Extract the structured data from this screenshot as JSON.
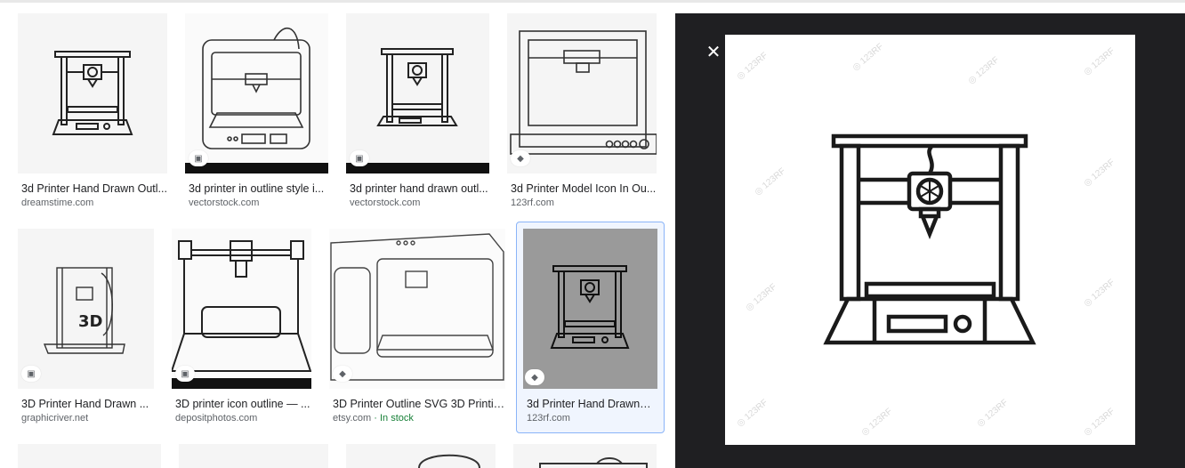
{
  "results": [
    {
      "title": "3d Printer Hand Drawn Outl...",
      "site": "dreamstime.com",
      "badge": "image-icon",
      "badge_show": false
    },
    {
      "title": "3d printer in outline style i...",
      "site": "vectorstock.com",
      "badge": "image-icon",
      "badge_show": true
    },
    {
      "title": "3d printer hand drawn outl...",
      "site": "vectorstock.com",
      "badge": "image-icon",
      "badge_show": true
    },
    {
      "title": "3d Printer Model Icon In Ou...",
      "site": "123rf.com",
      "badge": "tag-icon",
      "badge_show": true
    },
    {
      "title": "3D Printer Hand Drawn ...",
      "site": "graphicriver.net",
      "badge": "image-icon",
      "badge_show": true
    },
    {
      "title": "3D printer icon outline — ...",
      "site": "depositphotos.com",
      "badge": "image-icon",
      "badge_show": true
    },
    {
      "title": "3D Printer Outline SVG 3D Printin...",
      "site": "etsy.com",
      "stock": "· In stock",
      "badge": "tag-icon",
      "badge_show": true
    },
    {
      "title": "3d Printer Hand Drawn ...",
      "site": "123rf.com",
      "badge": "tag-icon",
      "badge_show": true
    }
  ],
  "viewer": {
    "close_label": "✕"
  },
  "icons": {
    "image": "▣",
    "tag": "◆"
  }
}
